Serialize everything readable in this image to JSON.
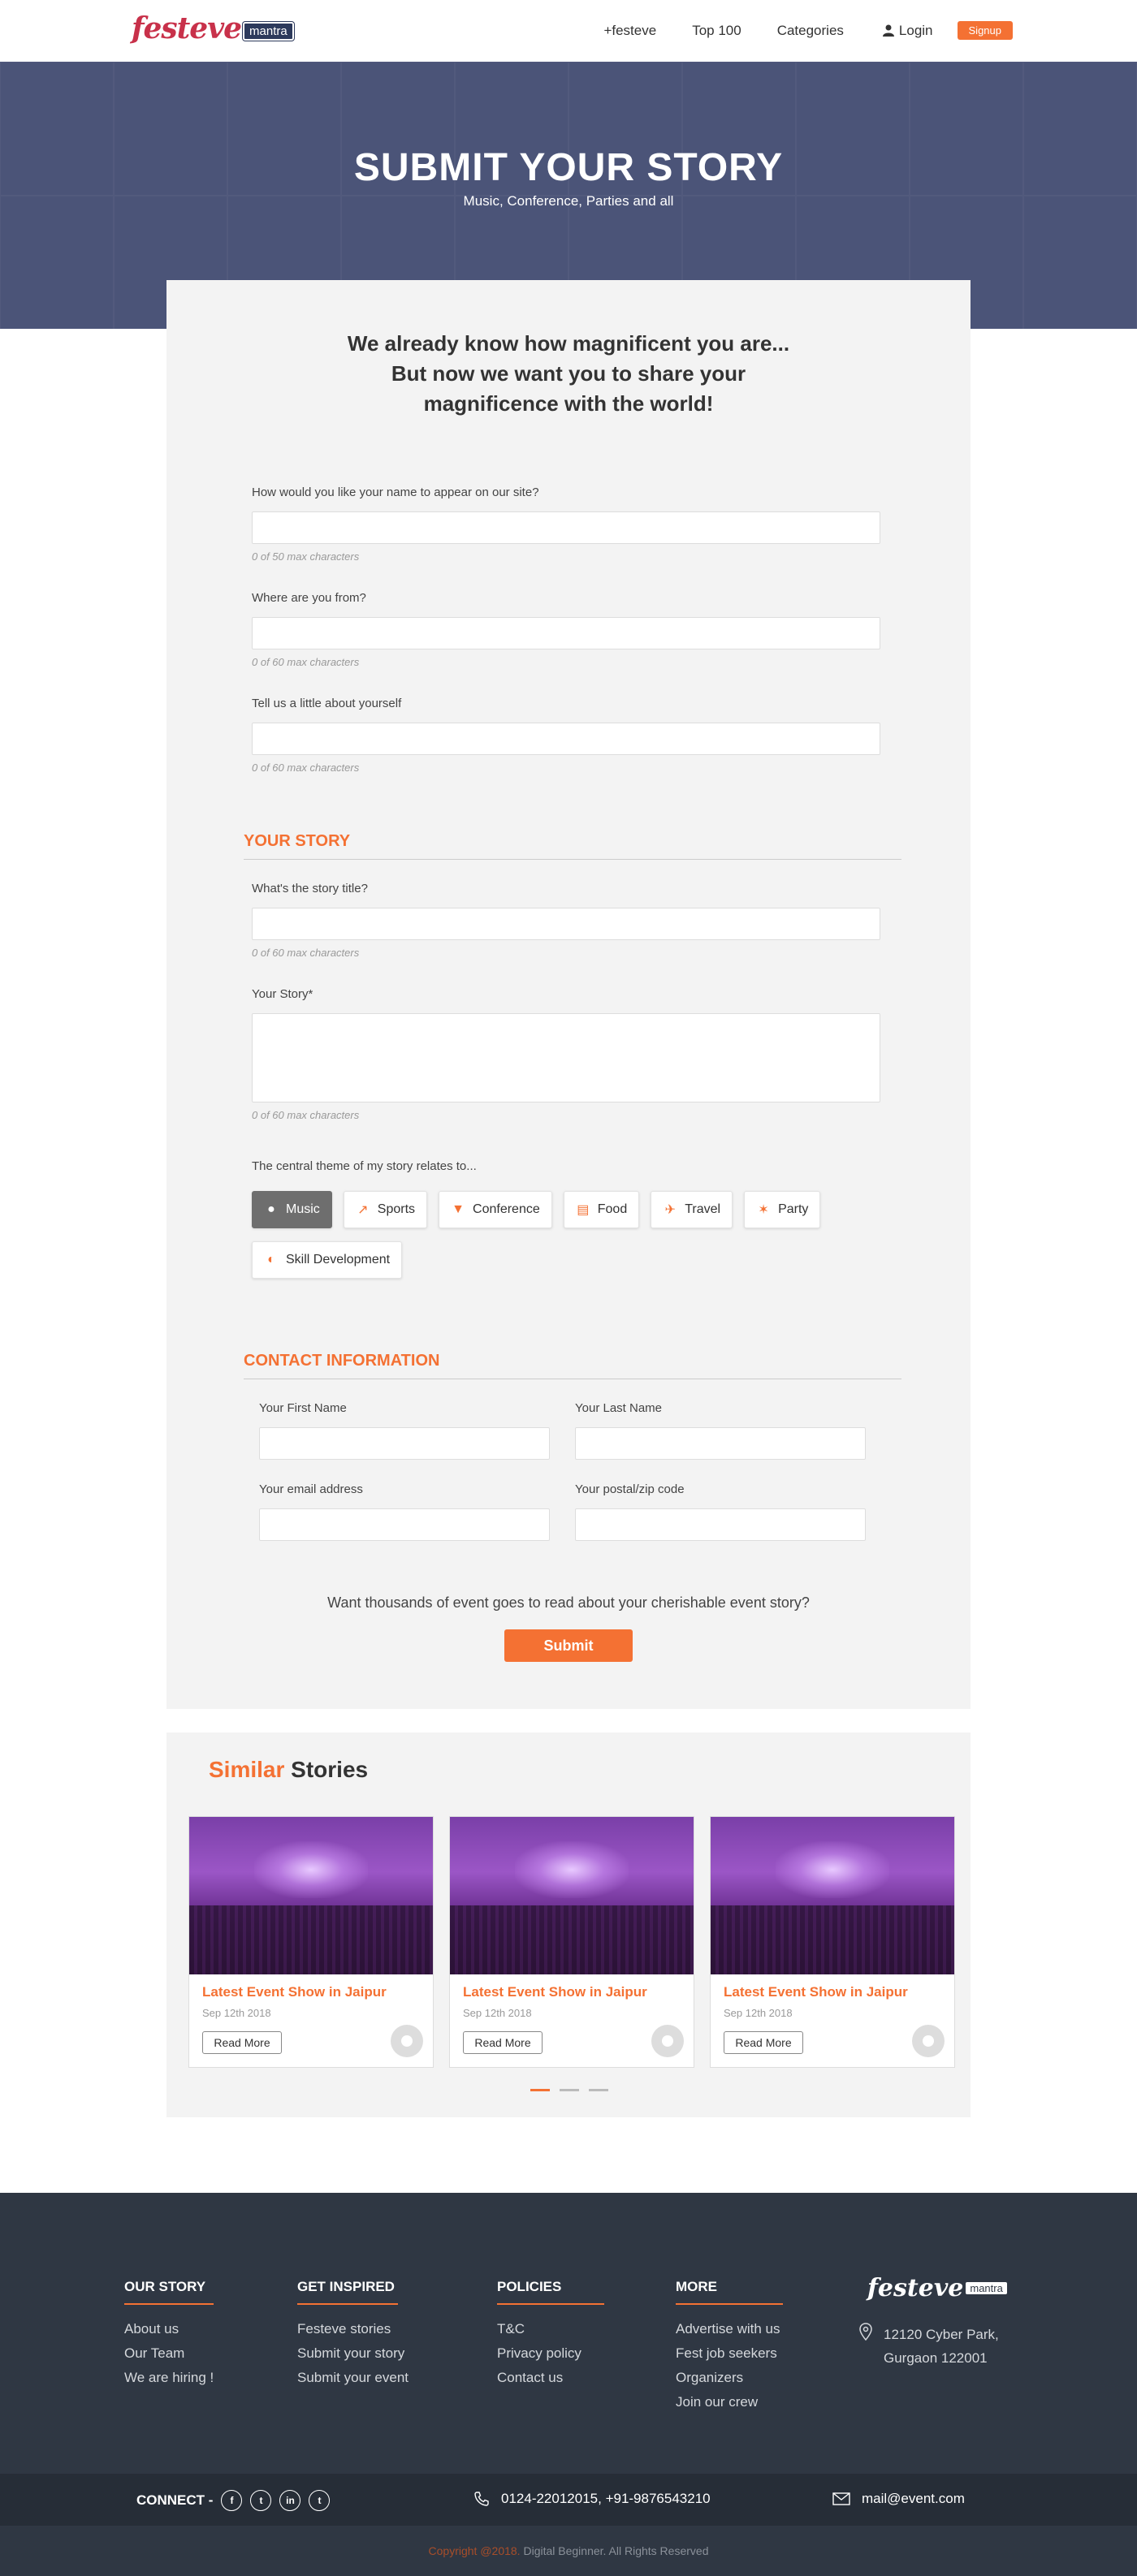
{
  "header": {
    "logo_text": "festeve",
    "logo_badge": "mantra",
    "nav": [
      "+festeve",
      "Top 100",
      "Categories"
    ],
    "login": "Login",
    "signup": "Signup"
  },
  "hero": {
    "title": "SUBMIT YOUR STORY",
    "subtitle": "Music, Conference, Parties and all"
  },
  "form": {
    "intro": [
      "We already know how magnificent you are...",
      "But now we want you to share your",
      "magnificence with the world!"
    ],
    "name_label": "How would you like your name to appear on our site?",
    "name_hint": "0 of 50 max characters",
    "from_label": "Where are you from?",
    "from_hint": "0 of 60 max characters",
    "about_label": "Tell us a little about yourself",
    "about_hint": "0 of 60 max characters",
    "story_section": "YOUR STORY",
    "story_title_label": "What's the story title?",
    "story_title_hint": "0 of 60 max characters",
    "story_label": "Your Story*",
    "story_hint": "0 of 60 max characters",
    "theme_label": "The central theme of my story relates to...",
    "themes": [
      {
        "label": "Music",
        "icon": "music-icon",
        "glyph": "●",
        "active": true
      },
      {
        "label": "Sports",
        "icon": "sports-icon",
        "glyph": "↗"
      },
      {
        "label": "Conference",
        "icon": "conference-icon",
        "glyph": "▼"
      },
      {
        "label": "Food",
        "icon": "food-icon",
        "glyph": "▤"
      },
      {
        "label": "Travel",
        "icon": "travel-icon",
        "glyph": "✈"
      },
      {
        "label": "Party",
        "icon": "party-icon",
        "glyph": "✶"
      },
      {
        "label": "Skill Development",
        "icon": "skill-icon",
        "glyph": "◐"
      }
    ],
    "contact_section": "CONTACT INFORMATION",
    "first_name_label": "Your First Name",
    "last_name_label": "Your Last Name",
    "email_label": "Your email address",
    "zip_label": "Your postal/zip code",
    "question": "Want thousands of event goes to read about your cherishable event story?",
    "submit": "Submit"
  },
  "similar": {
    "title_highlight": "Similar",
    "title_rest": "Stories",
    "cards": [
      {
        "title": "Latest Event Show in Jaipur",
        "date": "Sep 12th 2018",
        "button": "Read More"
      },
      {
        "title": "Latest Event Show in Jaipur",
        "date": "Sep 12th 2018",
        "button": "Read More"
      },
      {
        "title": "Latest Event Show in Jaipur",
        "date": "Sep 12th 2018",
        "button": "Read More"
      }
    ]
  },
  "footer": {
    "cols": [
      {
        "title": "OUR STORY",
        "items": [
          "About us",
          "Our Team",
          "We are hiring !"
        ]
      },
      {
        "title": "GET INSPIRED",
        "items": [
          "Festeve stories",
          "Submit your story",
          "Submit your event"
        ]
      },
      {
        "title": "POLICIES",
        "items": [
          "T&C",
          "Privacy policy",
          "Contact us"
        ]
      },
      {
        "title": "MORE",
        "items": [
          "Advertise with us",
          "Fest job seekers",
          "Organizers",
          "Join our crew"
        ]
      }
    ],
    "logo_text": "festeve",
    "logo_badge": "mantra",
    "address_line1": "12120 Cyber Park,",
    "address_line2": "Gurgaon 122001",
    "connect": "CONNECT -",
    "social": [
      "f",
      "t",
      "in",
      "t"
    ],
    "phone": "0124-22012015, +91-9876543210",
    "email": "mail@event.com",
    "copyright_a": "Copyright @2018.",
    "copyright_b": " Digital Beginner. All Rights Reserved"
  },
  "colors": {
    "accent": "#f47133",
    "footer": "#2f3743",
    "hero": "#4b5478"
  }
}
